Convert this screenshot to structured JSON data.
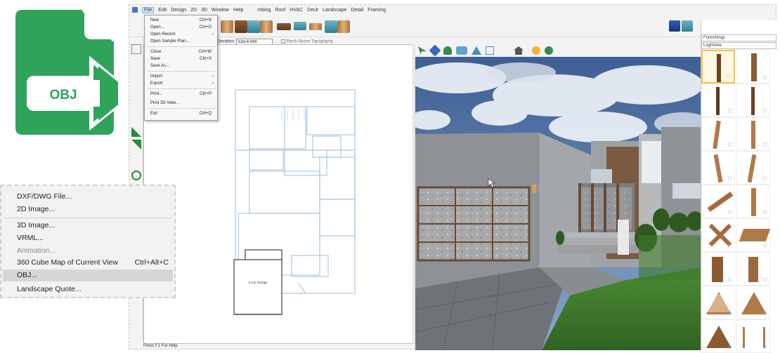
{
  "file_icon": {
    "label": "OBJ",
    "color": "#2fa35a"
  },
  "menubar": {
    "items": [
      {
        "label": "File",
        "active": true
      },
      {
        "label": "Edit"
      },
      {
        "label": "Design"
      },
      {
        "label": "2D"
      },
      {
        "label": "3D"
      },
      {
        "label": "Window"
      },
      {
        "label": "Help"
      }
    ],
    "tabs_partial": [
      "mbing",
      "Roof",
      "HVAC",
      "Deck",
      "Landscape",
      "Detail",
      "Framing"
    ]
  },
  "toolbar2": {
    "elevation_label": "Elevation:",
    "elevation_value": "533.4 mm",
    "pin_label": "Pinch Above Topography"
  },
  "file_menu": {
    "items": [
      {
        "label": "New",
        "shortcut": "Ctrl+N"
      },
      {
        "label": "Open...",
        "shortcut": "Ctrl+O"
      },
      {
        "label": "Open Recent",
        "submenu": true
      },
      {
        "label": "Open Sample Plan..."
      },
      {
        "label": "Close",
        "shortcut": "Ctrl+W"
      },
      {
        "label": "Save",
        "shortcut": "Ctrl+S"
      },
      {
        "label": "Save As..."
      },
      {
        "label": "Import",
        "submenu": true
      },
      {
        "label": "Export",
        "submenu": true
      },
      {
        "label": "Print...",
        "shortcut": "Ctrl+P"
      },
      {
        "label": "Print 3D View..."
      },
      {
        "label": "Exit",
        "shortcut": "Ctrl+Q"
      }
    ]
  },
  "export_menu": {
    "items": [
      {
        "label": "DXF/DWG File..."
      },
      {
        "label": "2D Image..."
      },
      {
        "label": "3D Image..."
      },
      {
        "label": "VRML..."
      },
      {
        "label": "Animation...",
        "disabled": true
      },
      {
        "label": "360 Cube Map of Current View",
        "shortcut": "Ctrl+Alt+C"
      },
      {
        "label": "OBJ...",
        "highlighted": true
      },
      {
        "label": "Landscape Quote..."
      }
    ]
  },
  "plan": {
    "garage_label": "2 Car Garage"
  },
  "library": {
    "category": "Furnishings",
    "subcategory": "LogHome",
    "star": "☆"
  },
  "statusbar": {
    "text": "Press F1 For Help"
  },
  "colors": {
    "accent_green": "#2fa35a",
    "blueprint": "#9fc3df",
    "sky": "#4a6fa3",
    "grass": "#3f7a2c",
    "wall": "#8f9398"
  }
}
